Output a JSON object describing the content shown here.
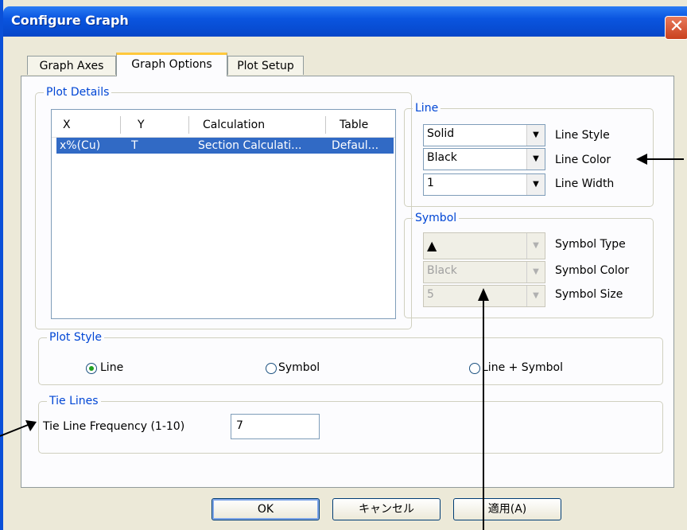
{
  "window": {
    "title": "Configure Graph",
    "close_glyph": "✕"
  },
  "tabs": [
    {
      "label": "Graph Axes"
    },
    {
      "label": "Graph Options"
    },
    {
      "label": "Plot Setup"
    }
  ],
  "plot_details": {
    "legend": "Plot Details",
    "columns": [
      "X",
      "Y",
      "Calculation",
      "Table"
    ],
    "rows": [
      {
        "x": "x%(Cu)",
        "y": "T",
        "calculation": "Section Calculati...",
        "table": "Defaul..."
      }
    ]
  },
  "line": {
    "legend": "Line",
    "style": {
      "value": "Solid",
      "label": "Line Style"
    },
    "color": {
      "value": "Black",
      "label": "Line Color"
    },
    "width": {
      "value": "1",
      "label": "Line Width"
    }
  },
  "symbol": {
    "legend": "Symbol",
    "type": {
      "value": "▲",
      "label": "Symbol Type"
    },
    "color": {
      "value": "Black",
      "label": "Symbol Color"
    },
    "size": {
      "value": "5",
      "label": "Symbol Size"
    }
  },
  "plot_style": {
    "legend": "Plot Style",
    "options": [
      "Line",
      "Symbol",
      "Line + Symbol"
    ],
    "selected": "Line"
  },
  "tie_lines": {
    "legend": "Tie Lines",
    "frequency_label": "Tie Line Frequency (1-10)",
    "frequency_value": "7"
  },
  "buttons": {
    "ok": "OK",
    "cancel": "キャンセル",
    "apply": "適用(A)"
  },
  "icons": {
    "dropdown": "▼"
  }
}
